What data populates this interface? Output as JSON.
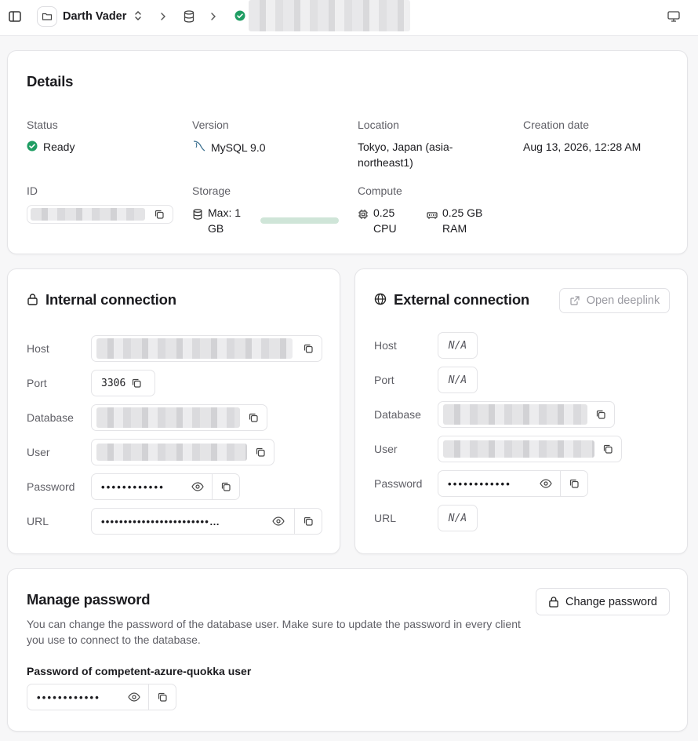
{
  "topbar": {
    "project_name": "Darth Vader"
  },
  "details": {
    "title": "Details",
    "status_label": "Status",
    "status_value": "Ready",
    "version_label": "Version",
    "version_value": "MySQL 9.0",
    "location_label": "Location",
    "location_value": "Tokyo, Japan (asia-northeast1)",
    "creation_label": "Creation date",
    "creation_value": "Aug 13, 2026, 12:28 AM",
    "id_label": "ID",
    "storage_label": "Storage",
    "storage_value": "Max: 1 GB",
    "storage_usage_percent": 100,
    "compute_label": "Compute",
    "cpu_value": "0.25 CPU",
    "ram_value": "0.25 GB RAM"
  },
  "internal": {
    "title": "Internal connection",
    "host_label": "Host",
    "port_label": "Port",
    "port_value": "3306",
    "database_label": "Database",
    "user_label": "User",
    "password_label": "Password",
    "password_value": "••••••••••••",
    "url_label": "URL",
    "url_value": "••••••••••••••••••••••••…"
  },
  "external": {
    "title": "External connection",
    "deeplink_label": "Open deeplink",
    "host_label": "Host",
    "host_value": "N/A",
    "port_label": "Port",
    "port_value": "N/A",
    "database_label": "Database",
    "user_label": "User",
    "password_label": "Password",
    "password_value": "••••••••••••",
    "url_label": "URL",
    "url_value": "N/A"
  },
  "manage": {
    "title": "Manage password",
    "description": "You can change the password of the database user. Make sure to update the password in every client you use to connect to the database.",
    "change_button": "Change password",
    "password_field_label": "Password of competent-azure-quokka user",
    "password_value": "••••••••••••"
  },
  "colors": {
    "status_ready": "#1f9d63",
    "storage_bar": "#cfe5d8",
    "border": "#e4e4e7"
  },
  "icons": [
    "sidebar-toggle-icon",
    "folder-icon",
    "chevron-updown-icon",
    "chevron-right-icon",
    "database-icon",
    "check-circle-icon",
    "monitor-icon",
    "dolphin-icon",
    "copy-icon",
    "cpu-icon",
    "memory-icon",
    "lock-icon",
    "globe-icon",
    "external-link-icon",
    "eye-icon"
  ]
}
